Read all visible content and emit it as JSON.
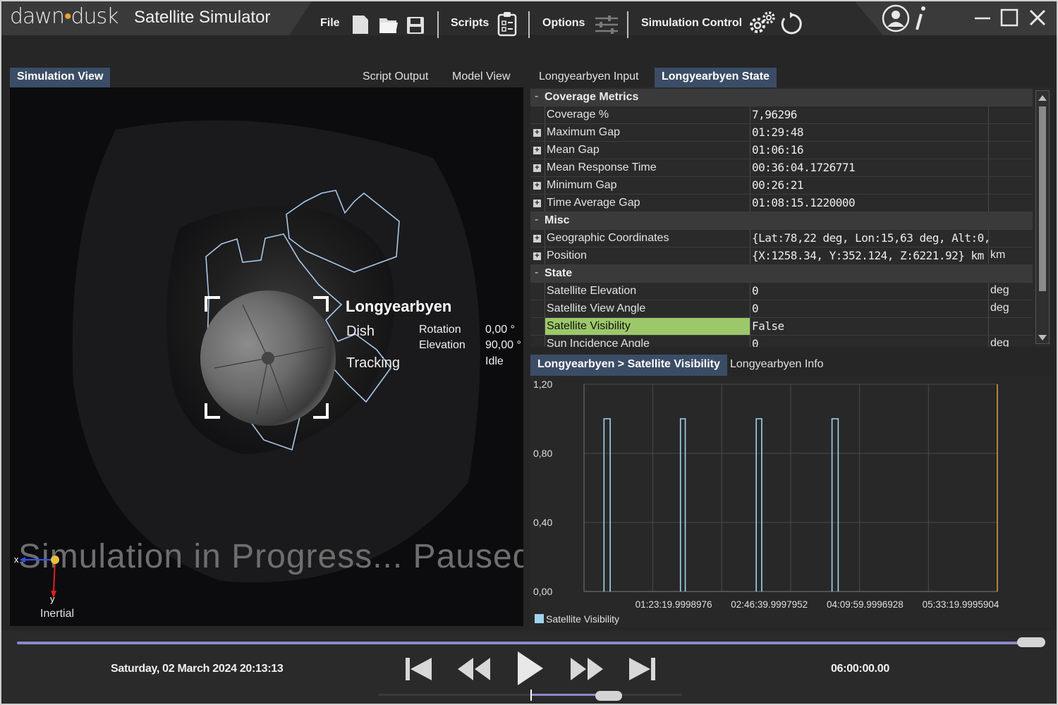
{
  "app": {
    "brand_left": "dawn",
    "brand_right": "dusk",
    "title": "Satellite Simulator"
  },
  "menu": {
    "file": "File",
    "scripts": "Scripts",
    "options": "Options",
    "simulation_control": "Simulation Control"
  },
  "left_tabs": [
    "Simulation View",
    "Script Output",
    "Model View"
  ],
  "viewport": {
    "station_name": "Longyearbyen",
    "dish_label": "Dish",
    "tracking_label": "Tracking",
    "rotation_label": "Rotation",
    "rotation_value": "0,00 °",
    "elevation_label": "Elevation",
    "elevation_value": "90,00 °",
    "status": "Idle",
    "progress_text": "Simulation in Progress... Paused",
    "axis_x": "x",
    "axis_y": "y",
    "frame_label": "Inertial"
  },
  "right_tabs": [
    "Longyearbyen Input",
    "Longyearbyen State"
  ],
  "properties": {
    "groups": [
      {
        "name": "Coverage Metrics",
        "rows": [
          {
            "name": "Coverage %",
            "value": "7,96296",
            "unit": "",
            "expandable": false
          },
          {
            "name": "Maximum Gap",
            "value": "01:29:48",
            "unit": "",
            "expandable": true
          },
          {
            "name": "Mean Gap",
            "value": "01:06:16",
            "unit": "",
            "expandable": true
          },
          {
            "name": "Mean Response Time",
            "value": "00:36:04.1726771",
            "unit": "",
            "expandable": true
          },
          {
            "name": "Minimum Gap",
            "value": "00:26:21",
            "unit": "",
            "expandable": true
          },
          {
            "name": "Time Average Gap",
            "value": "01:08:15.1220000",
            "unit": "",
            "expandable": true
          }
        ]
      },
      {
        "name": "Misc",
        "rows": [
          {
            "name": "Geographic Coordinates",
            "value": "{Lat:78,22 deg, Lon:15,63 deg, Alt:0,",
            "unit": "",
            "expandable": true
          },
          {
            "name": "Position",
            "value": "{X:1258.34, Y:352.124, Z:6221.92} km",
            "unit": "km",
            "expandable": true
          }
        ]
      },
      {
        "name": "State",
        "rows": [
          {
            "name": "Satellite Elevation",
            "value": "0",
            "unit": "deg",
            "expandable": false
          },
          {
            "name": "Satellite View Angle",
            "value": "0",
            "unit": "deg",
            "expandable": false
          },
          {
            "name": "Satellite Visibility",
            "value": "False",
            "unit": "",
            "expandable": false,
            "highlight": true
          },
          {
            "name": "Sun Incidence Angle",
            "value": "0",
            "unit": "deg",
            "expandable": false
          }
        ]
      }
    ]
  },
  "chart_tabs": [
    "Longyearbyen > Satellite Visibility",
    "Longyearbyen Info"
  ],
  "chart_data": {
    "type": "line",
    "title": "",
    "xlabel": "",
    "ylabel": "",
    "ylim": [
      0,
      1.2
    ],
    "y_ticks": [
      "0,00",
      "0,40",
      "0,80",
      "1,20"
    ],
    "x_ticks": [
      "01:23:19.9998976",
      "02:46:39.9997952",
      "04:09:59.9996928",
      "05:33:19.9995904"
    ],
    "xlim_hours": [
      0,
      6
    ],
    "grid": true,
    "legend_position": "bottom-left",
    "series": [
      {
        "name": "Satellite Visibility",
        "color": "#9fd4ee",
        "pulses_hours": [
          [
            0.29,
            0.38
          ],
          [
            1.4,
            1.47
          ],
          [
            2.5,
            2.58
          ],
          [
            3.6,
            3.69
          ]
        ],
        "on_value": 1.0,
        "off_value": 0.0
      }
    ],
    "cursor_color": "#e0a040"
  },
  "playback": {
    "datetime": "Saturday, 02 March 2024 20:13:13",
    "duration": "06:00:00.00",
    "timeline_position": 0.997,
    "speed_position": 0.75
  },
  "colors": {
    "accent": "#8b89c9",
    "tab_active": "#3b4d66",
    "highlight": "#9cc86a",
    "outline": "#a9c8e8"
  }
}
